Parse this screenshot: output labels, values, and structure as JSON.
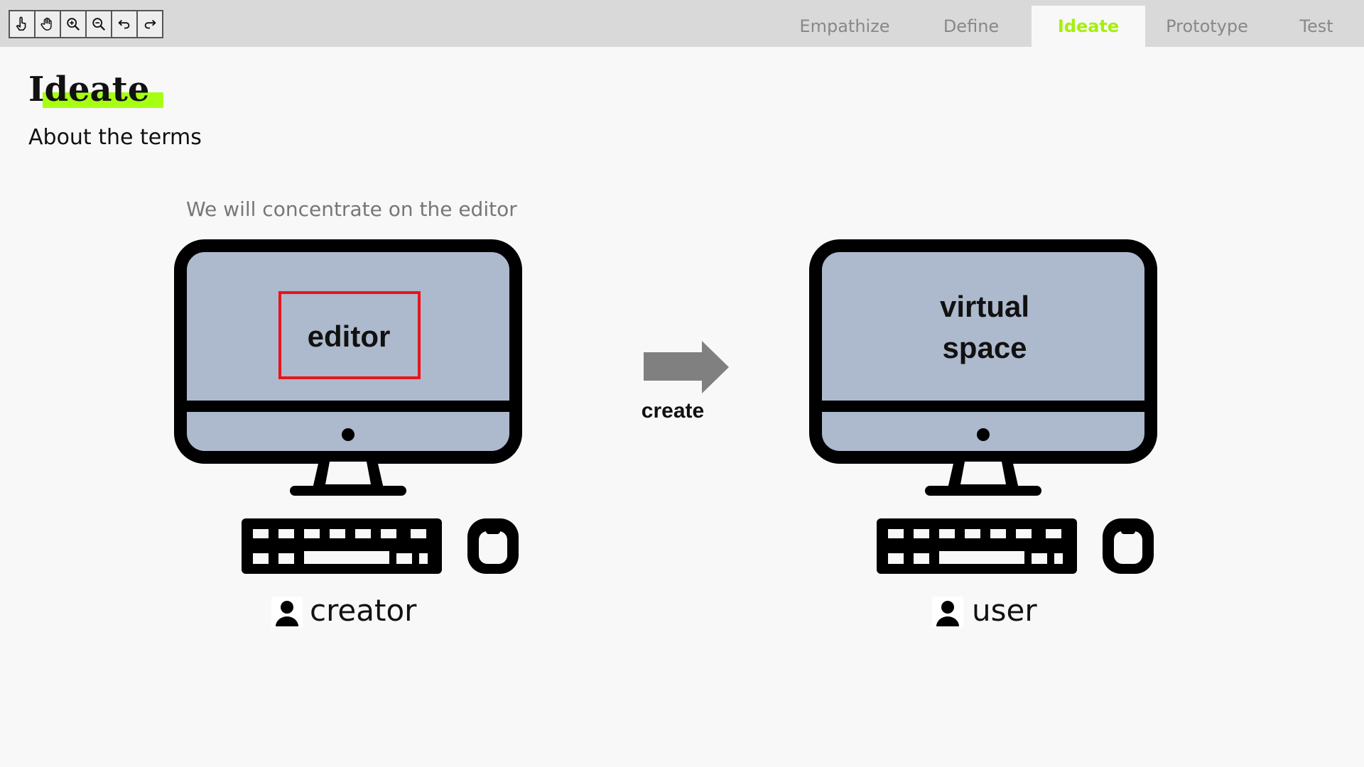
{
  "toolbar": {
    "tools": [
      {
        "icon": "pointer-hand-icon"
      },
      {
        "icon": "pan-hand-icon"
      },
      {
        "icon": "zoom-in-icon"
      },
      {
        "icon": "zoom-out-icon"
      },
      {
        "icon": "undo-icon"
      },
      {
        "icon": "redo-icon"
      }
    ]
  },
  "tabs": [
    {
      "label": "Empathize",
      "active": false
    },
    {
      "label": "Define",
      "active": false
    },
    {
      "label": "Ideate",
      "active": true
    },
    {
      "label": "Prototype",
      "active": false
    },
    {
      "label": "Test",
      "active": false
    }
  ],
  "page": {
    "title": "Ideate",
    "subtitle": "About the terms",
    "caption": "We will concentrate on the editor"
  },
  "diagram": {
    "left_screen_label": "editor",
    "right_screen_label_line1": "virtual",
    "right_screen_label_line2": "space",
    "arrow_label": "create",
    "left_person": "creator",
    "right_person": "user"
  },
  "colors": {
    "accent": "#a6ff12",
    "active_tab_text": "#a4f00a",
    "screen_fill": "#adb9cc",
    "highlight_box": "#e8141c",
    "arrow": "#808080",
    "topbar": "#d9d9d9"
  }
}
